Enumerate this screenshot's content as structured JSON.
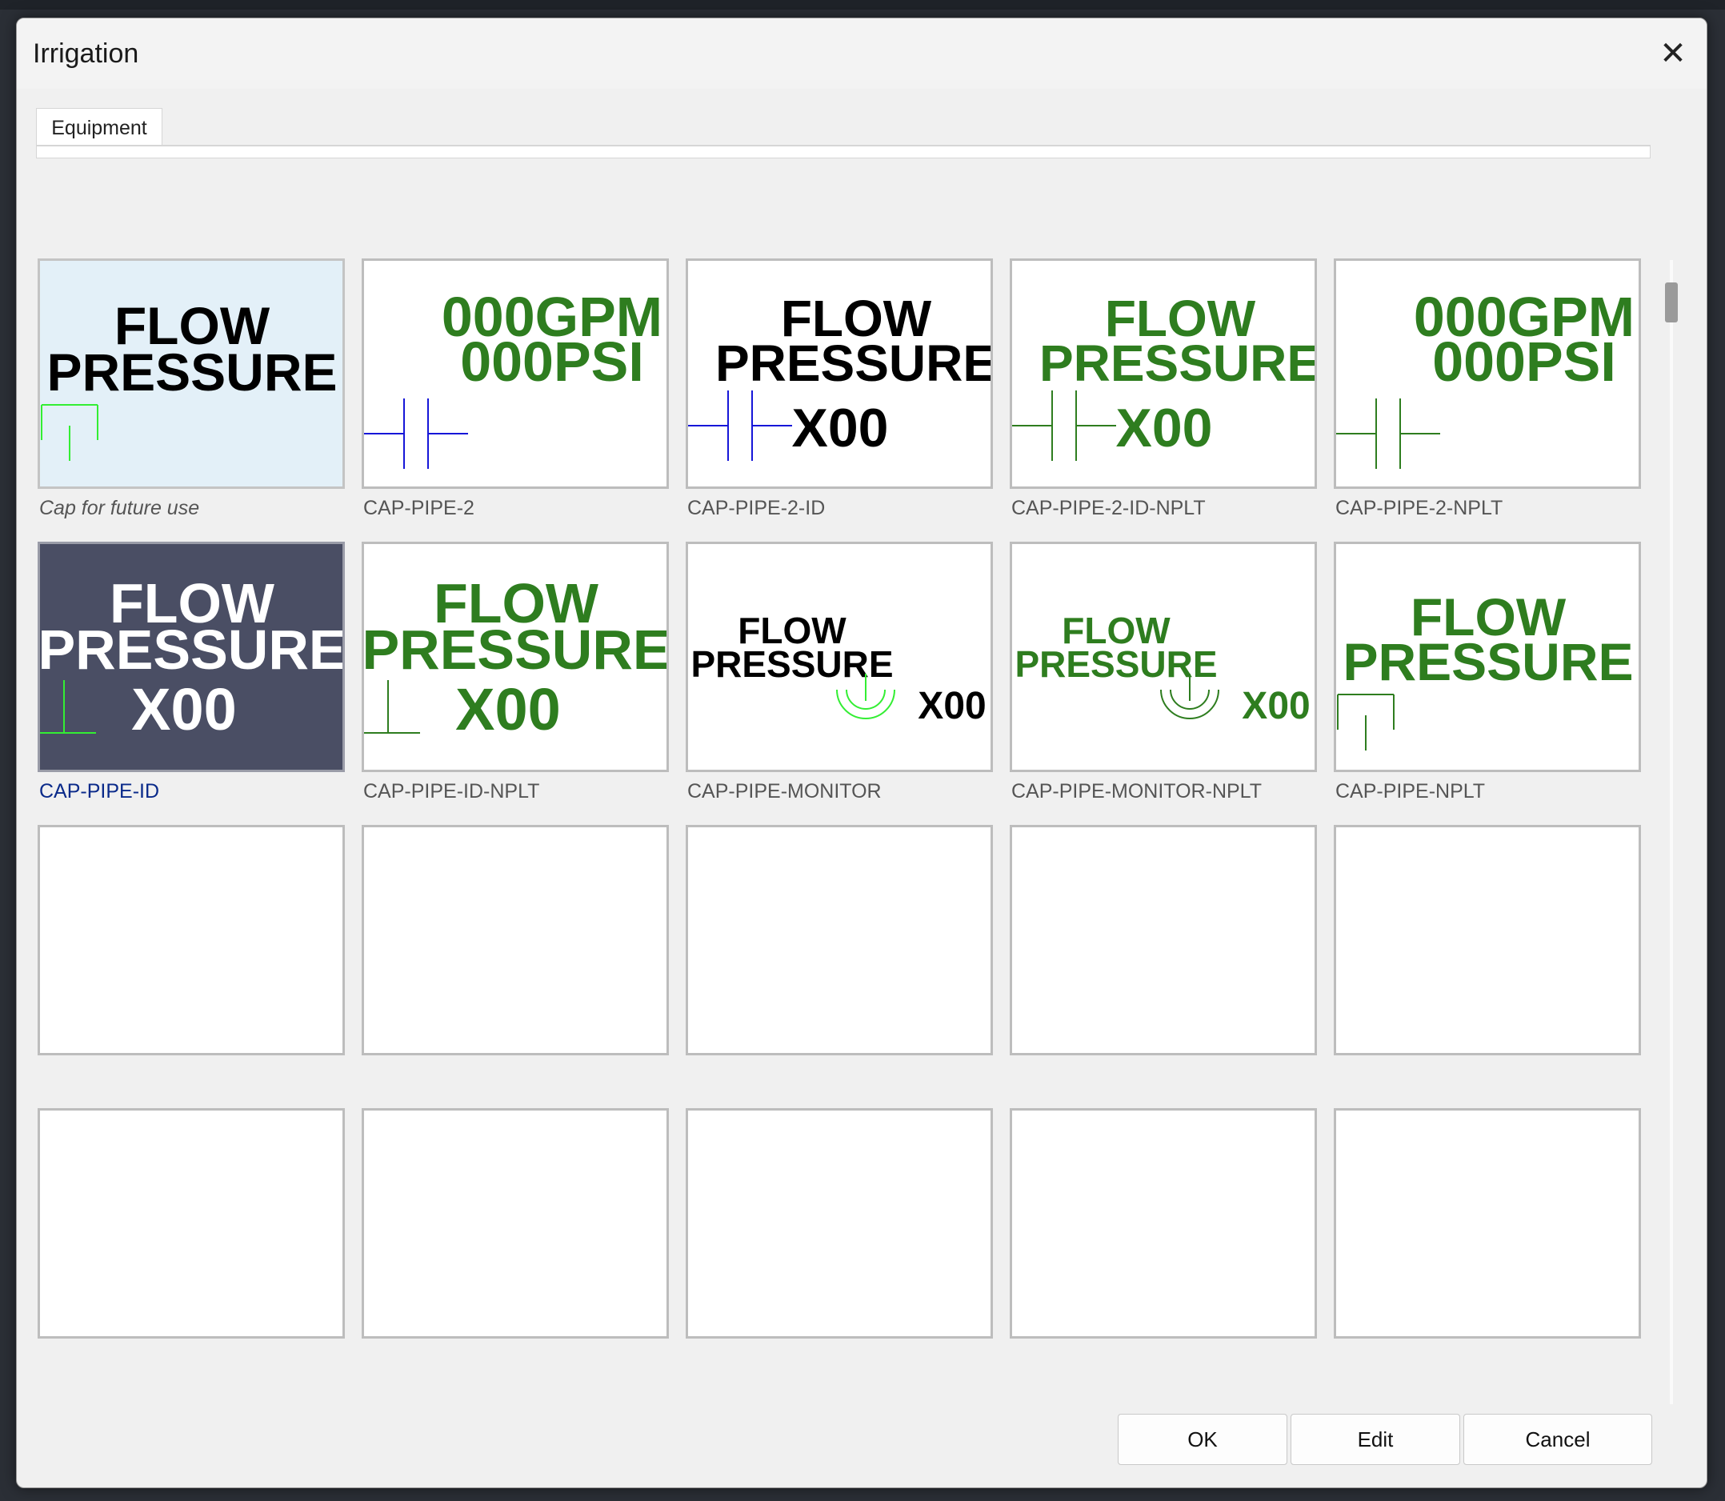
{
  "window": {
    "title": "Irrigation"
  },
  "tabs": [
    {
      "label": "Equipment"
    }
  ],
  "colors": {
    "green": "#2e7d1f",
    "light_green": "#33ee33",
    "blue": "#1616d8",
    "black": "#000000",
    "white": "#ffffff",
    "selected_bg": "#4a4e64",
    "hover_bg": "#e3f0f8"
  },
  "blocks": [
    {
      "name": "Cap for future use",
      "style": "italic",
      "preview": {
        "lines": [
          "FLOW",
          "PRESSURE"
        ],
        "text_color": "black",
        "symbol": "cap",
        "symbol_color": "light_green"
      }
    },
    {
      "name": "CAP-PIPE-2",
      "preview": {
        "lines": [
          "000GPM",
          "000PSI"
        ],
        "text_color": "green",
        "symbol": "double-bar",
        "symbol_color": "blue"
      }
    },
    {
      "name": "CAP-PIPE-2-ID",
      "preview": {
        "lines": [
          "FLOW",
          "PRESSURE"
        ],
        "tag": "X00",
        "text_color": "black",
        "symbol": "double-bar",
        "symbol_color": "blue"
      }
    },
    {
      "name": "CAP-PIPE-2-ID-NPLT",
      "preview": {
        "lines": [
          "FLOW",
          "PRESSURE"
        ],
        "tag": "X00",
        "text_color": "green",
        "symbol": "double-bar",
        "symbol_color": "green"
      }
    },
    {
      "name": "CAP-PIPE-2-NPLT",
      "preview": {
        "lines": [
          "000GPM",
          "000PSI"
        ],
        "text_color": "green",
        "symbol": "double-bar",
        "symbol_color": "green"
      }
    },
    {
      "name": "CAP-PIPE-ID",
      "selected": true,
      "preview": {
        "lines": [
          "FLOW",
          "PRESSURE"
        ],
        "tag": "X00",
        "text_color": "white",
        "symbol": "tee",
        "symbol_color": "light_green"
      }
    },
    {
      "name": "CAP-PIPE-ID-NPLT",
      "preview": {
        "lines": [
          "FLOW",
          "PRESSURE"
        ],
        "tag": "X00",
        "text_color": "green",
        "symbol": "tee",
        "symbol_color": "green"
      }
    },
    {
      "name": "CAP-PIPE-MONITOR",
      "preview": {
        "lines": [
          "FLOW",
          "PRESSURE"
        ],
        "tag": "X00",
        "text_color": "black",
        "symbol": "monitor",
        "symbol_color": "light_green"
      }
    },
    {
      "name": "CAP-PIPE-MONITOR-NPLT",
      "preview": {
        "lines": [
          "FLOW",
          "PRESSURE"
        ],
        "tag": "X00",
        "text_color": "green",
        "symbol": "monitor",
        "symbol_color": "green"
      }
    },
    {
      "name": "CAP-PIPE-NPLT",
      "preview": {
        "lines": [
          "FLOW",
          "PRESSURE"
        ],
        "text_color": "green",
        "symbol": "cap",
        "symbol_color": "green"
      }
    }
  ],
  "empty_slots": 10,
  "buttons": {
    "ok": "OK",
    "edit": "Edit",
    "cancel": "Cancel"
  }
}
